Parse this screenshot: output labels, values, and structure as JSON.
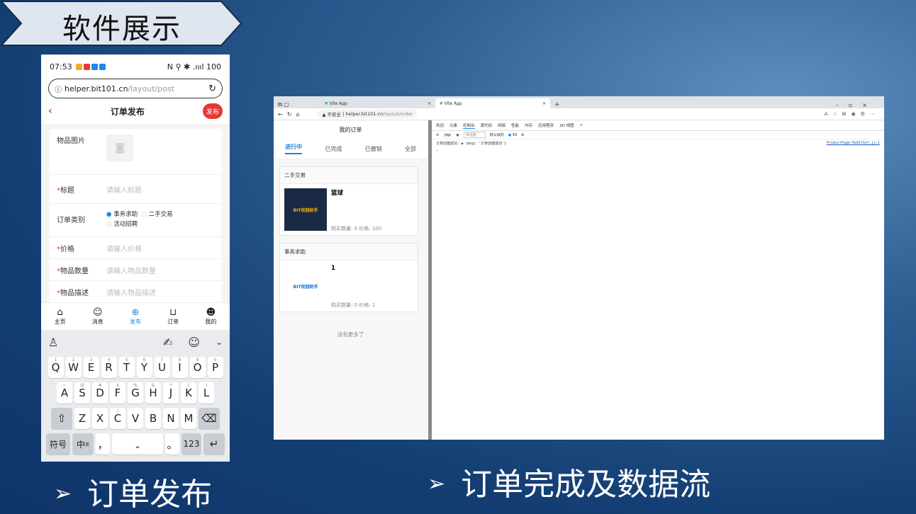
{
  "slide": {
    "title": "软件展示",
    "caption_left": "订单发布",
    "caption_right": "订单完成及数据流",
    "bullet": "➢"
  },
  "phone": {
    "time": "07:53",
    "status_right": "N ⚲ ✱ .ıııl 100",
    "url_host": "helper.bit101.cn",
    "url_path": "/layout/post",
    "header_title": "订单发布",
    "publish_button": "发布",
    "form": {
      "image_label": "物品图片",
      "title_label": "标题",
      "title_placeholder": "请输入标题",
      "type_label": "订单类别",
      "type_options": [
        "事务求助",
        "二手交易",
        "活动招聘"
      ],
      "price_label": "价格",
      "price_placeholder": "请输入价格",
      "qty_label": "物品数量",
      "qty_placeholder": "请输入物品数量",
      "desc_label": "物品描述",
      "desc_placeholder": "请输入物品描述"
    },
    "tabs": [
      "主页",
      "消息",
      "发布",
      "订单",
      "我的"
    ],
    "keyboard": {
      "row1": [
        "Q",
        "W",
        "E",
        "R",
        "T",
        "Y",
        "U",
        "I",
        "O",
        "P"
      ],
      "row1_sub": [
        "1",
        "2",
        "3",
        "4",
        "5",
        "6",
        "7",
        "8",
        "9",
        "0"
      ],
      "row2": [
        "A",
        "S",
        "D",
        "F",
        "G",
        "H",
        "J",
        "K",
        "L"
      ],
      "row2_sub": [
        "~",
        "@",
        "#",
        "$",
        "%",
        "&",
        "*",
        "(",
        ")"
      ],
      "row3": [
        "Z",
        "X",
        "C",
        "V",
        "B",
        "N",
        "M"
      ],
      "row3_sub": [
        "",
        "",
        "/",
        "",
        "",
        "",
        ""
      ],
      "key_symbols": "符号",
      "key_lang": "中",
      "key_lang_sub": "英",
      "key_comma": "，",
      "key_period": "。",
      "key_num": "123"
    }
  },
  "browser": {
    "tab1": "Vite App",
    "tab2": "Vite App",
    "insecure": "▲ 不安全",
    "url_host": "helper.bit101.cn",
    "url_path": "/layout/order",
    "app": {
      "header": "我的订单",
      "tabs": [
        "进行中",
        "已完成",
        "已撤销",
        "全部"
      ],
      "cards": [
        {
          "section": "二手交易",
          "title": "篮球",
          "info": "购买数量: 0 价格: 100",
          "thumb": "BIT校园助手"
        },
        {
          "section": "事务求助",
          "title": "1",
          "info": "购买数量: 0 价格: 1",
          "thumb": "BIT校园助手"
        }
      ],
      "no_more": "没有更多了"
    },
    "devtools": {
      "tabs": [
        "欢迎",
        "元素",
        "控制台",
        "源代码",
        "网络",
        "性能",
        "内存",
        "应用程序",
        "3D 视图",
        "+"
      ],
      "filter_placeholder": "筛选器",
      "level": "默认级别",
      "context": "top",
      "issues": "99",
      "log_text": "订单创建成功: ▶ {msg: '订单创建成功'}",
      "log_source": "ProductPage-0a91f1ef.js:1"
    }
  }
}
